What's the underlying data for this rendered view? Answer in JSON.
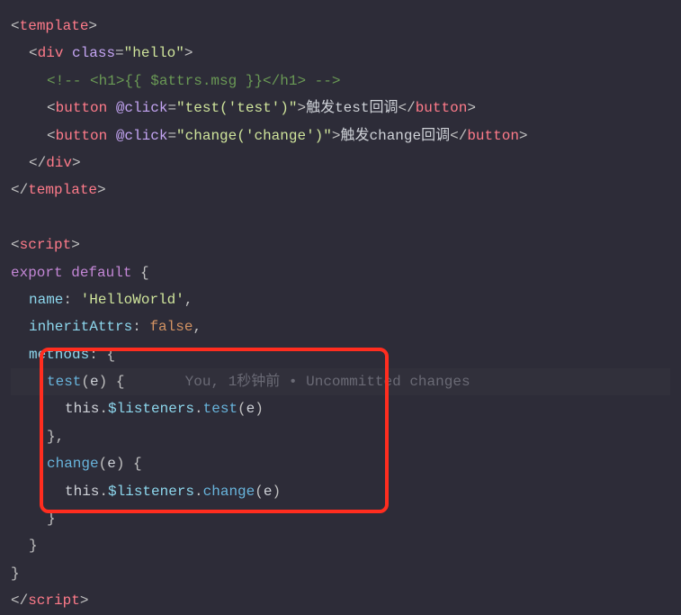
{
  "code": {
    "template_open": "template",
    "div_tag": "div",
    "class_attr": "class",
    "class_val": "\"hello\"",
    "comment_line": "<!-- <h1>{{ $attrs.msg }}</h1> -->",
    "button_tag": "button",
    "click_attr": "@click",
    "test_click_val": "\"test('test')\"",
    "test_btn_text": "触发test回调",
    "change_click_val": "\"change('change')\"",
    "change_btn_text": "触发change回调",
    "script_tag": "script",
    "export_kw": "export",
    "default_kw": "default",
    "name_prop": "name",
    "name_val": "'HelloWorld'",
    "inherit_prop": "inheritAttrs",
    "false_val": "false",
    "methods_prop": "methods",
    "test_fn": "test",
    "param_e": "e",
    "this_kw": "this",
    "listeners_prop": "$listeners",
    "test_call": "test",
    "change_fn": "change",
    "change_call": "change",
    "brace_open": "{",
    "brace_close": "}",
    "brace_close_comma": "},",
    "lt": "<",
    "gt": ">",
    "lt_slash": "</",
    "eq": "=",
    "comma": ",",
    "colon": ":",
    "dot": ".",
    "paren_open": "(",
    "paren_close": ")"
  },
  "blame": {
    "author": "You",
    "when": "1秒钟前",
    "sep": " • ",
    "msg": "Uncommitted changes"
  }
}
